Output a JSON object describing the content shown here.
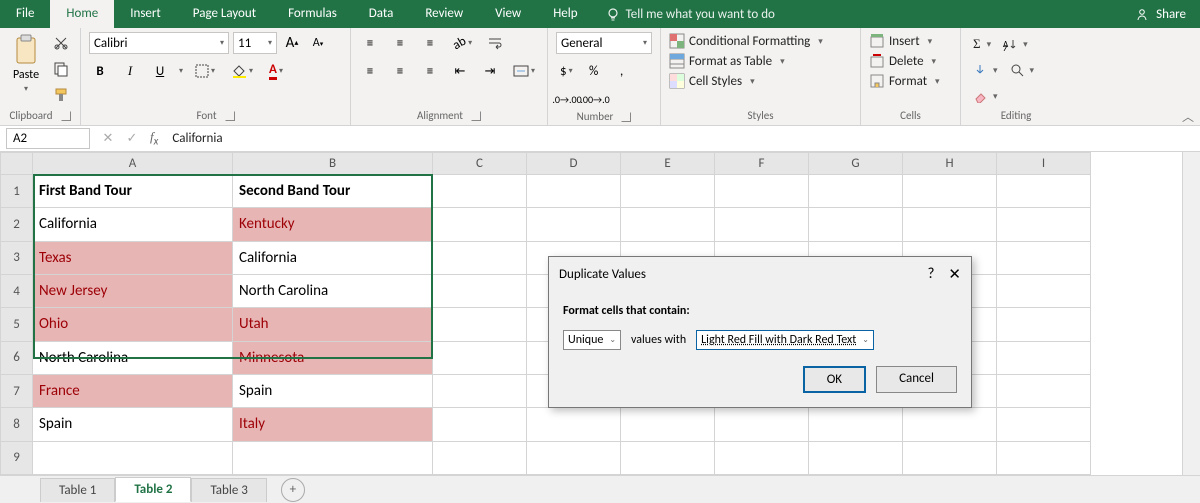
{
  "tabs": {
    "file": "File",
    "home": "Home",
    "insert": "Insert",
    "pagelayout": "Page Layout",
    "formulas": "Formulas",
    "data": "Data",
    "review": "Review",
    "view": "View",
    "help": "Help",
    "tellme": "Tell me what you want to do",
    "share": "Share"
  },
  "ribbon": {
    "clipboard": {
      "paste": "Paste",
      "label": "Clipboard"
    },
    "font": {
      "name": "Calibri",
      "size": "11",
      "label": "Font"
    },
    "alignment": {
      "label": "Alignment"
    },
    "number": {
      "format": "General",
      "label": "Number"
    },
    "styles": {
      "cond": "Conditional Formatting",
      "table": "Format as Table",
      "cell": "Cell Styles",
      "label": "Styles"
    },
    "cells": {
      "insert": "Insert",
      "delete": "Delete",
      "format": "Format",
      "label": "Cells"
    },
    "editing": {
      "label": "Editing"
    }
  },
  "namebox": "A2",
  "formula": "California",
  "columns": [
    "A",
    "B",
    "C",
    "D",
    "E",
    "F",
    "G",
    "H",
    "I"
  ],
  "rows": [
    "1",
    "2",
    "3",
    "4",
    "5",
    "6",
    "7",
    "8",
    "9"
  ],
  "data": {
    "headerA": "First Band Tour",
    "headerB": "Second Band Tour",
    "A2": "California",
    "B2": "Kentucky",
    "A3": "Texas",
    "B3": "California",
    "A4": "New Jersey",
    "B4": "North Carolina",
    "A5": "Ohio",
    "B5": "Utah",
    "A6": "North Carolina",
    "B6": "Minnesota",
    "A7": "France",
    "B7": "Spain",
    "A8": "Spain",
    "B8": "Italy"
  },
  "sheets": {
    "t1": "Table 1",
    "t2": "Table 2",
    "t3": "Table 3"
  },
  "dialog": {
    "title": "Duplicate Values",
    "help": "?",
    "close": "✕",
    "subtitle": "Format cells that contain:",
    "values_label": "values with",
    "sel1": "Unique",
    "sel2": "Light Red Fill with Dark Red Text",
    "ok": "OK",
    "cancel": "Cancel"
  }
}
